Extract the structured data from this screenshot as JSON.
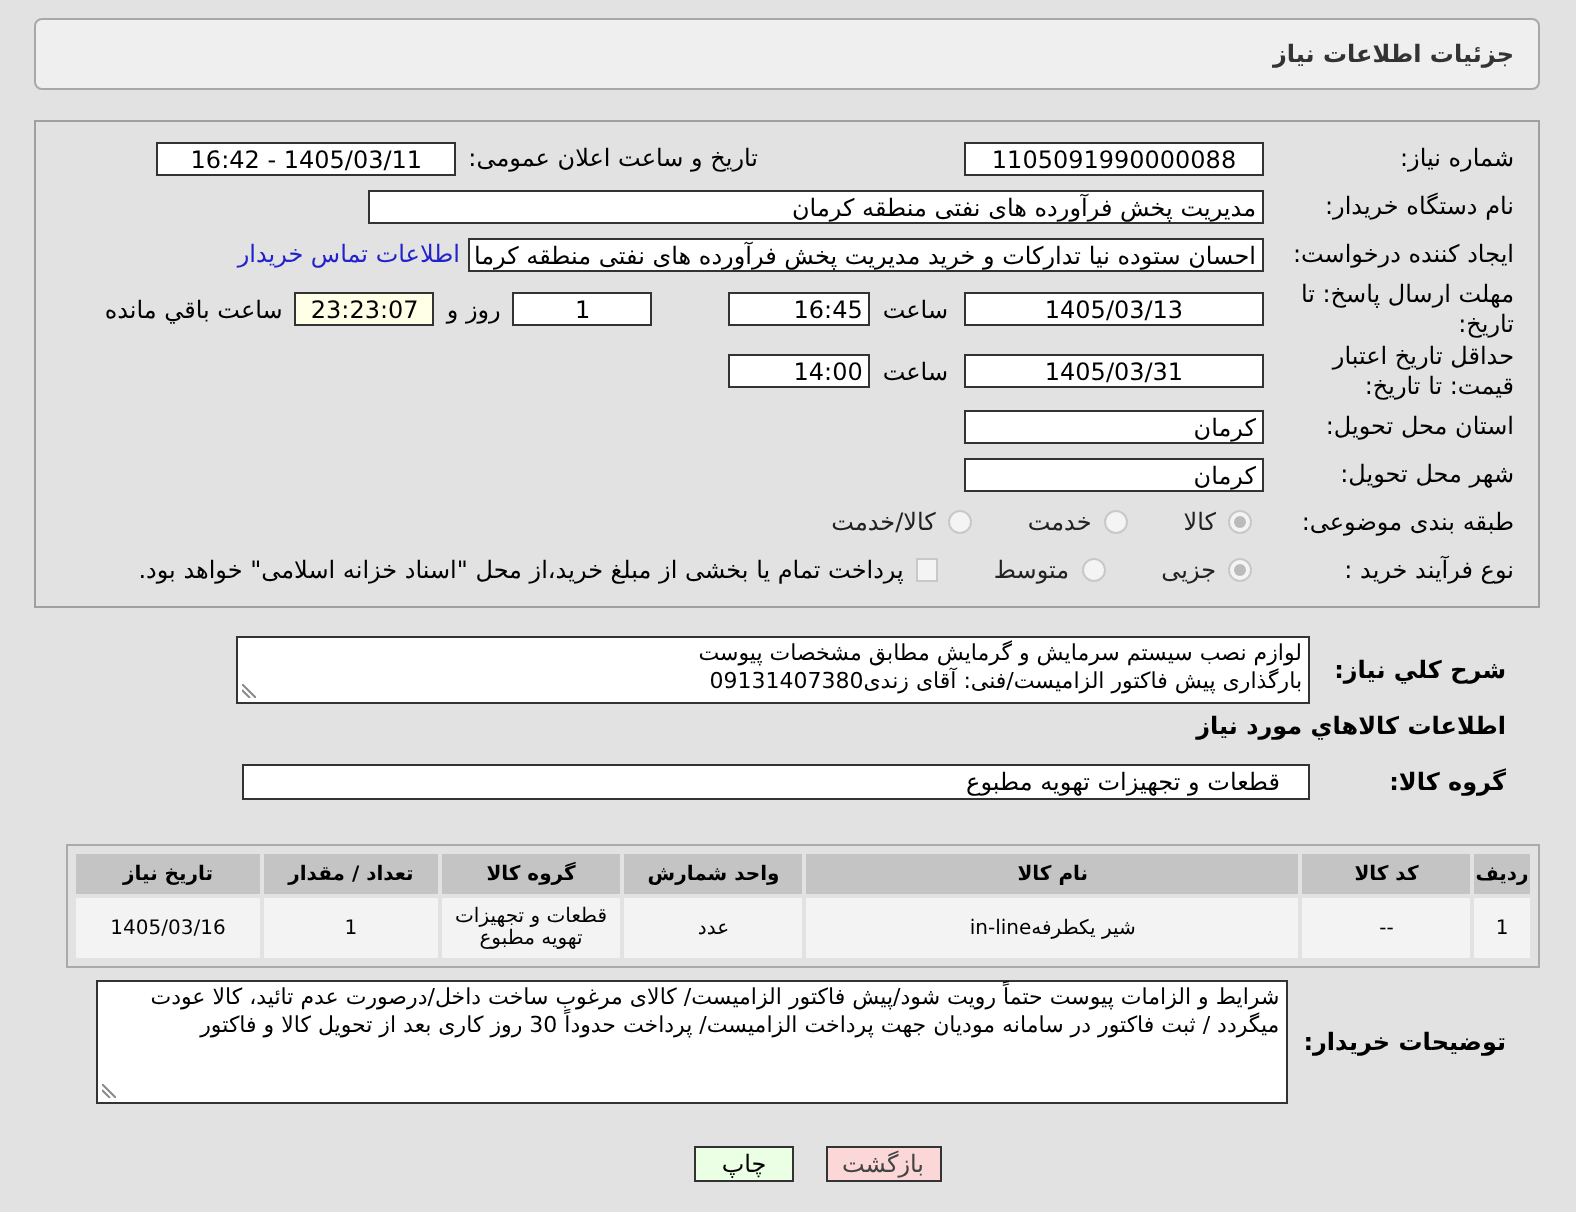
{
  "header": {
    "title": "جزئیات اطلاعات نیاز"
  },
  "form": {
    "need_number": {
      "label": "شماره نیاز:",
      "value": "1105091990000088"
    },
    "announce": {
      "label": "تاریخ و ساعت اعلان عمومی:",
      "value": "1405/03/11 - 16:42"
    },
    "buyer_org": {
      "label": "نام دستگاه خریدار:",
      "value": "مدیریت پخش فرآورده های نفتی منطقه کرمان"
    },
    "creator": {
      "label": "ایجاد کننده درخواست:",
      "value": "احسان  ستوده نیا  تدارکات و خرید  مدیریت پخش فرآورده های نفتی منطقه کرما",
      "link": "اطلاعات تماس خریدار"
    },
    "deadline": {
      "label": "مهلت ارسال پاسخ: تا تاریخ:",
      "date": "1405/03/13",
      "time_label": "ساعت",
      "time": "16:45",
      "days": "1",
      "days_label": "روز و",
      "remaining": "23:23:07",
      "remaining_label": "ساعت باقي مانده"
    },
    "validity": {
      "label": "حداقل تاریخ اعتبار قیمت: تا تاریخ:",
      "date": "1405/03/31",
      "time_label": "ساعت",
      "time": "14:00"
    },
    "province": {
      "label": "استان محل تحویل:",
      "value": "کرمان"
    },
    "city": {
      "label": "شهر محل تحویل:",
      "value": "کرمان"
    },
    "category": {
      "label": "طبقه بندی موضوعی:",
      "options": [
        {
          "label": "کالا",
          "selected": true
        },
        {
          "label": "خدمت",
          "selected": false
        },
        {
          "label": "کالا/خدمت",
          "selected": false
        }
      ]
    },
    "process": {
      "label": "نوع فرآیند خرید :",
      "options": [
        {
          "label": "جزیی",
          "selected": true
        },
        {
          "label": "متوسط",
          "selected": false
        }
      ],
      "treasury": {
        "checked": false,
        "text": "پرداخت تمام یا بخشی از مبلغ خرید،از محل \"اسناد خزانه اسلامی\" خواهد بود."
      }
    }
  },
  "description": {
    "label": "شرح کلي نیاز:",
    "value": "لوازم نصب سیستم سرمایش و گرمایش مطابق مشخصات پیوست\nبارگذاری پیش فاکتور الزامیست/فنی: آقای زندی09131407380"
  },
  "goods": {
    "title": "اطلاعات کالاهاي مورد نیاز",
    "group_label": "گروه کالا:",
    "group": "قطعات و تجهیزات تهویه مطبوع",
    "table": {
      "columns": [
        "ردیف",
        "کد کالا",
        "نام کالا",
        "واحد شمارش",
        "گروه کالا",
        "تعداد / مقدار",
        "تاریخ نیاز"
      ],
      "rows": [
        [
          "1",
          "--",
          "شیر یکطرفهin-line",
          "عدد",
          "قطعات و تجهیزات تهویه مطبوع",
          "1",
          "1405/03/16"
        ]
      ]
    }
  },
  "buyer_notes": {
    "label": "توضیحات خریدار:",
    "value": "شرایط و الزامات پیوست حتماً رویت شود/پیش فاکتور الزامیست/ کالای مرغوب ساخت داخل/درصورت عدم تائید، کالا عودت میگردد / ثبت فاکتور در سامانه مودیان جهت پرداخت الزامیست/ پرداخت حدوداً 30 روز کاری بعد از تحویل کالا و فاکتور"
  },
  "buttons": [
    {
      "label": "بازگشت",
      "kind": "back"
    },
    {
      "label": "چاپ",
      "kind": "print"
    }
  ]
}
